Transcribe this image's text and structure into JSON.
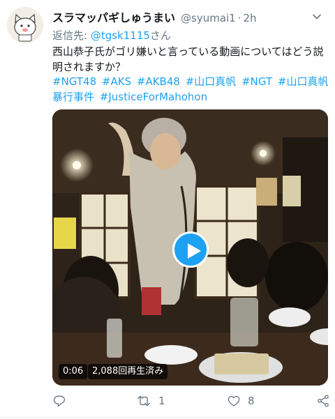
{
  "user": {
    "display_name": "スラマッパギしゅうまい",
    "handle": "@syumai1",
    "separator": "·",
    "time": "2h"
  },
  "reply": {
    "prefix": "返信先: ",
    "mention": "@tgsk1115",
    "suffix": "さん"
  },
  "tweet": {
    "text": "西山恭子氏がゴリ嫌いと言っている動画についてはどう説明されますか？",
    "hashtags": [
      "#NGT48",
      "#AKS",
      "#AKB48",
      "#山口真帆",
      "#NGT",
      "#山口真帆暴行事件",
      "#JusticeForMahohon"
    ]
  },
  "media": {
    "duration": "0:06",
    "views": "2,088回再生済み"
  },
  "actions": {
    "reply_count": "",
    "retweet_count": "1",
    "like_count": "8"
  },
  "colors": {
    "accent": "#1da1f2",
    "secondary_text": "#657786",
    "primary_text": "#14171a"
  }
}
